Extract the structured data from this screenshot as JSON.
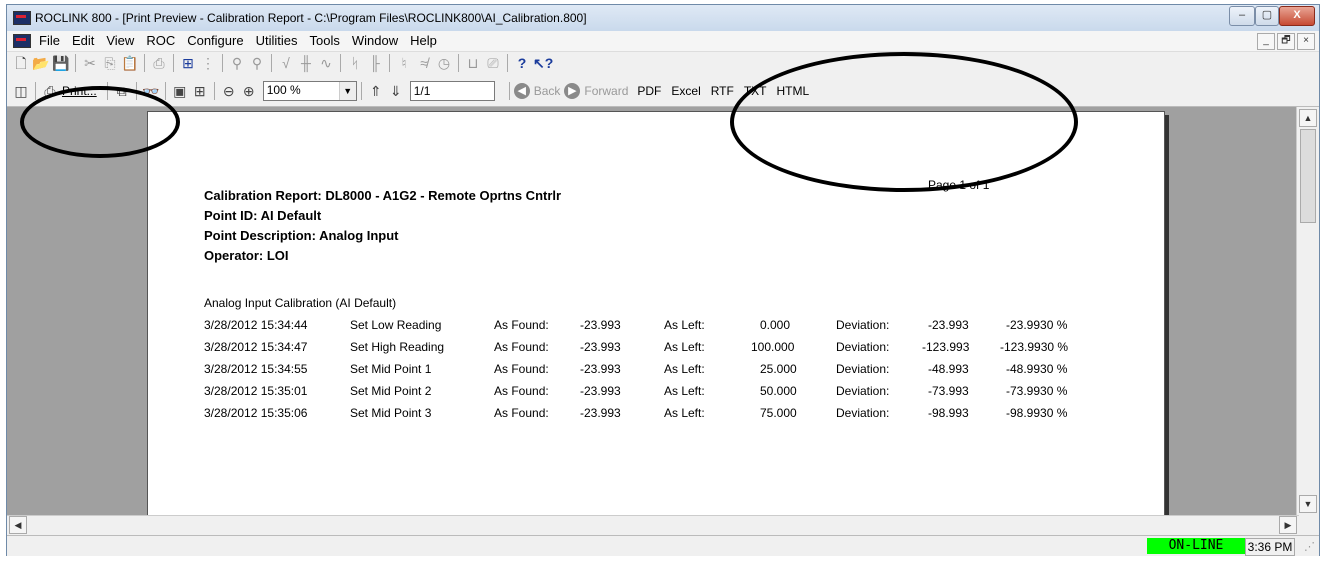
{
  "window": {
    "title": "ROCLINK 800 - [Print Preview - Calibration Report - C:\\Program Files\\ROCLINK800\\AI_Calibration.800]",
    "minimize": "–",
    "maximize": "▢",
    "close": "X"
  },
  "menu": {
    "items": [
      "File",
      "Edit",
      "View",
      "ROC",
      "Configure",
      "Utilities",
      "Tools",
      "Window",
      "Help"
    ],
    "mdi_min": "_",
    "mdi_restore": "🗗",
    "mdi_close": "×"
  },
  "preview_toolbar": {
    "print_label": "Print...",
    "zoom_value": "100 %",
    "page_value": "1/1",
    "back_label": "Back",
    "forward_label": "Forward",
    "formats": [
      "PDF",
      "Excel",
      "RTF",
      "TXT",
      "HTML"
    ]
  },
  "report": {
    "page_label": "Page   1   of   1",
    "title": "Calibration Report:  DL8000 - A1G2 - Remote Oprtns Cntrlr",
    "point_id": "Point ID:  AI Default",
    "point_description": "Point Description:  Analog Input",
    "operator": "Operator:  LOI",
    "section_title": "Analog Input Calibration (AI Default)",
    "rows": [
      {
        "timestamp": "3/28/2012 15:34:44",
        "action": "Set Low Reading",
        "as_found_label": "As Found:",
        "as_found": "-23.993",
        "as_left_label": "As Left:",
        "as_left": "0.000",
        "deviation_label": "Deviation:",
        "deviation": "-23.993",
        "deviation_pct": "-23.9930 %"
      },
      {
        "timestamp": "3/28/2012 15:34:47",
        "action": "Set High Reading",
        "as_found_label": "As Found:",
        "as_found": "-23.993",
        "as_left_label": "As Left:",
        "as_left": "100.000",
        "deviation_label": "Deviation:",
        "deviation": "-123.993",
        "deviation_pct": "-123.9930 %"
      },
      {
        "timestamp": "3/28/2012 15:34:55",
        "action": "Set Mid Point 1",
        "as_found_label": "As Found:",
        "as_found": "-23.993",
        "as_left_label": "As Left:",
        "as_left": "25.000",
        "deviation_label": "Deviation:",
        "deviation": "-48.993",
        "deviation_pct": "-48.9930 %"
      },
      {
        "timestamp": "3/28/2012 15:35:01",
        "action": "Set Mid Point 2",
        "as_found_label": "As Found:",
        "as_found": "-23.993",
        "as_left_label": "As Left:",
        "as_left": "50.000",
        "deviation_label": "Deviation:",
        "deviation": "-73.993",
        "deviation_pct": "-73.9930 %"
      },
      {
        "timestamp": "3/28/2012 15:35:06",
        "action": "Set Mid Point 3",
        "as_found_label": "As Found:",
        "as_found": "-23.993",
        "as_left_label": "As Left:",
        "as_left": "75.000",
        "deviation_label": "Deviation:",
        "deviation": "-98.993",
        "deviation_pct": "-98.9930 %"
      }
    ]
  },
  "status": {
    "online": "ON-LINE",
    "time": "3:36 PM"
  },
  "colors": {
    "online_bg": "#00ff00",
    "preview_bg": "#a0a0a0"
  }
}
